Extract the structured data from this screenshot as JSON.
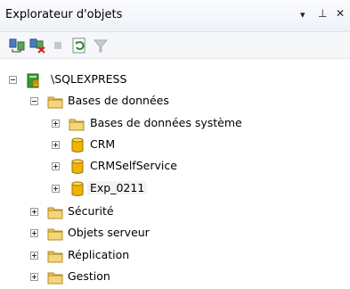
{
  "panel": {
    "title": "Explorateur d'objets",
    "controls": {
      "dropdown": "▾",
      "pin": "⊥",
      "close": "✕"
    }
  },
  "toolbar": {
    "buttons": [
      {
        "name": "connect",
        "icon": "connect-icon"
      },
      {
        "name": "disconnect",
        "icon": "disconnect-icon"
      },
      {
        "name": "stop",
        "icon": "stop-icon"
      },
      {
        "name": "refresh",
        "icon": "refresh-icon"
      },
      {
        "name": "filter",
        "icon": "filter-icon"
      }
    ]
  },
  "tree": {
    "server": {
      "label": "\\SQLEXPRESS",
      "state": "expanded"
    },
    "databases": {
      "label": "Bases de données",
      "state": "expanded"
    },
    "system_databases": {
      "label": "Bases de données système",
      "state": "collapsed"
    },
    "db_items": [
      {
        "label": "CRM",
        "state": "collapsed"
      },
      {
        "label": "CRMSelfService",
        "state": "collapsed"
      },
      {
        "label": "Exp_0211",
        "state": "collapsed"
      }
    ],
    "folders": [
      {
        "label": "Sécurité",
        "state": "collapsed"
      },
      {
        "label": "Objets serveur",
        "state": "collapsed"
      },
      {
        "label": "Réplication",
        "state": "collapsed"
      },
      {
        "label": "Gestion",
        "state": "collapsed"
      }
    ]
  },
  "colors": {
    "folder": "#e8c45a",
    "database": "#f0b400",
    "server": "#3a9a2c"
  }
}
